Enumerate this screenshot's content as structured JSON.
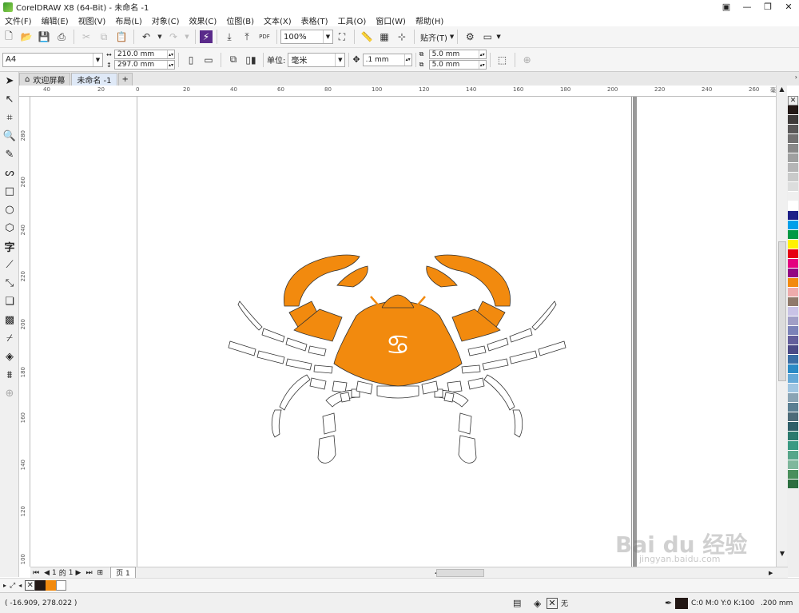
{
  "app": {
    "title": "CorelDRAW X8 (64-Bit) - 未命名 -1"
  },
  "menu": [
    "文件(F)",
    "编辑(E)",
    "视图(V)",
    "布局(L)",
    "对象(C)",
    "效果(C)",
    "位图(B)",
    "文本(X)",
    "表格(T)",
    "工具(O)",
    "窗口(W)",
    "帮助(H)"
  ],
  "toolbar": {
    "zoom": "100%",
    "snap_label": "贴齐(T)",
    "pdf_label": "PDF"
  },
  "property_bar": {
    "page_size": "A4",
    "width": "210.0 mm",
    "height": "297.0 mm",
    "units_label": "单位:",
    "units_value": "毫米",
    "nudge": ".1 mm",
    "dup_x": "5.0 mm",
    "dup_y": "5.0 mm"
  },
  "tabs": [
    {
      "label": "欢迎屏幕"
    },
    {
      "label": "未命名 -1"
    }
  ],
  "ruler": {
    "h_ticks": [
      "40",
      "20",
      "0",
      "20",
      "40",
      "60",
      "80",
      "100",
      "120",
      "140",
      "160",
      "180",
      "200",
      "220",
      "240",
      "260"
    ],
    "h_unit": "毫米",
    "v_ticks": [
      "280",
      "260",
      "240",
      "220",
      "200",
      "180",
      "160",
      "140",
      "120",
      "100"
    ]
  },
  "drawing": {
    "crab_color": "#f28a0e",
    "symbol": "♋"
  },
  "page_nav": {
    "current": "1",
    "of_label": "的",
    "total": "1",
    "page_tab": "页 1"
  },
  "status": {
    "coords": "( -16.909, 278.022 )",
    "fill_label": "无",
    "color_info": "C:0 M:0 Y:0 K:100",
    "outline_width": ".200 mm"
  },
  "palette": [
    "#231815",
    "#3e3a39",
    "#595757",
    "#727171",
    "#898989",
    "#9fa0a0",
    "#b5b5b6",
    "#c9caca",
    "#dcdddd",
    "#efefef",
    "#ffffff",
    "#1d2088",
    "#00a0e9",
    "#009944",
    "#fff100",
    "#e60012",
    "#e4007f",
    "#920783",
    "#f28a0e",
    "#eeabab",
    "#8f7a6b",
    "#c9c3e6",
    "#a09ec6",
    "#7b82b8",
    "#635e9b",
    "#4b4a86",
    "#3a6ea5",
    "#2a8ac5",
    "#65a9d7",
    "#9fc5e1",
    "#8aa4b4",
    "#5b7f92",
    "#4d6b78",
    "#2f5f69",
    "#2b7a6e",
    "#3a9a83",
    "#57a68a",
    "#7fb79c",
    "#4a8f5c",
    "#2b6e3f"
  ],
  "watermark": {
    "main": "Bai du 经验",
    "sub": "jingyan.baidu.com"
  }
}
